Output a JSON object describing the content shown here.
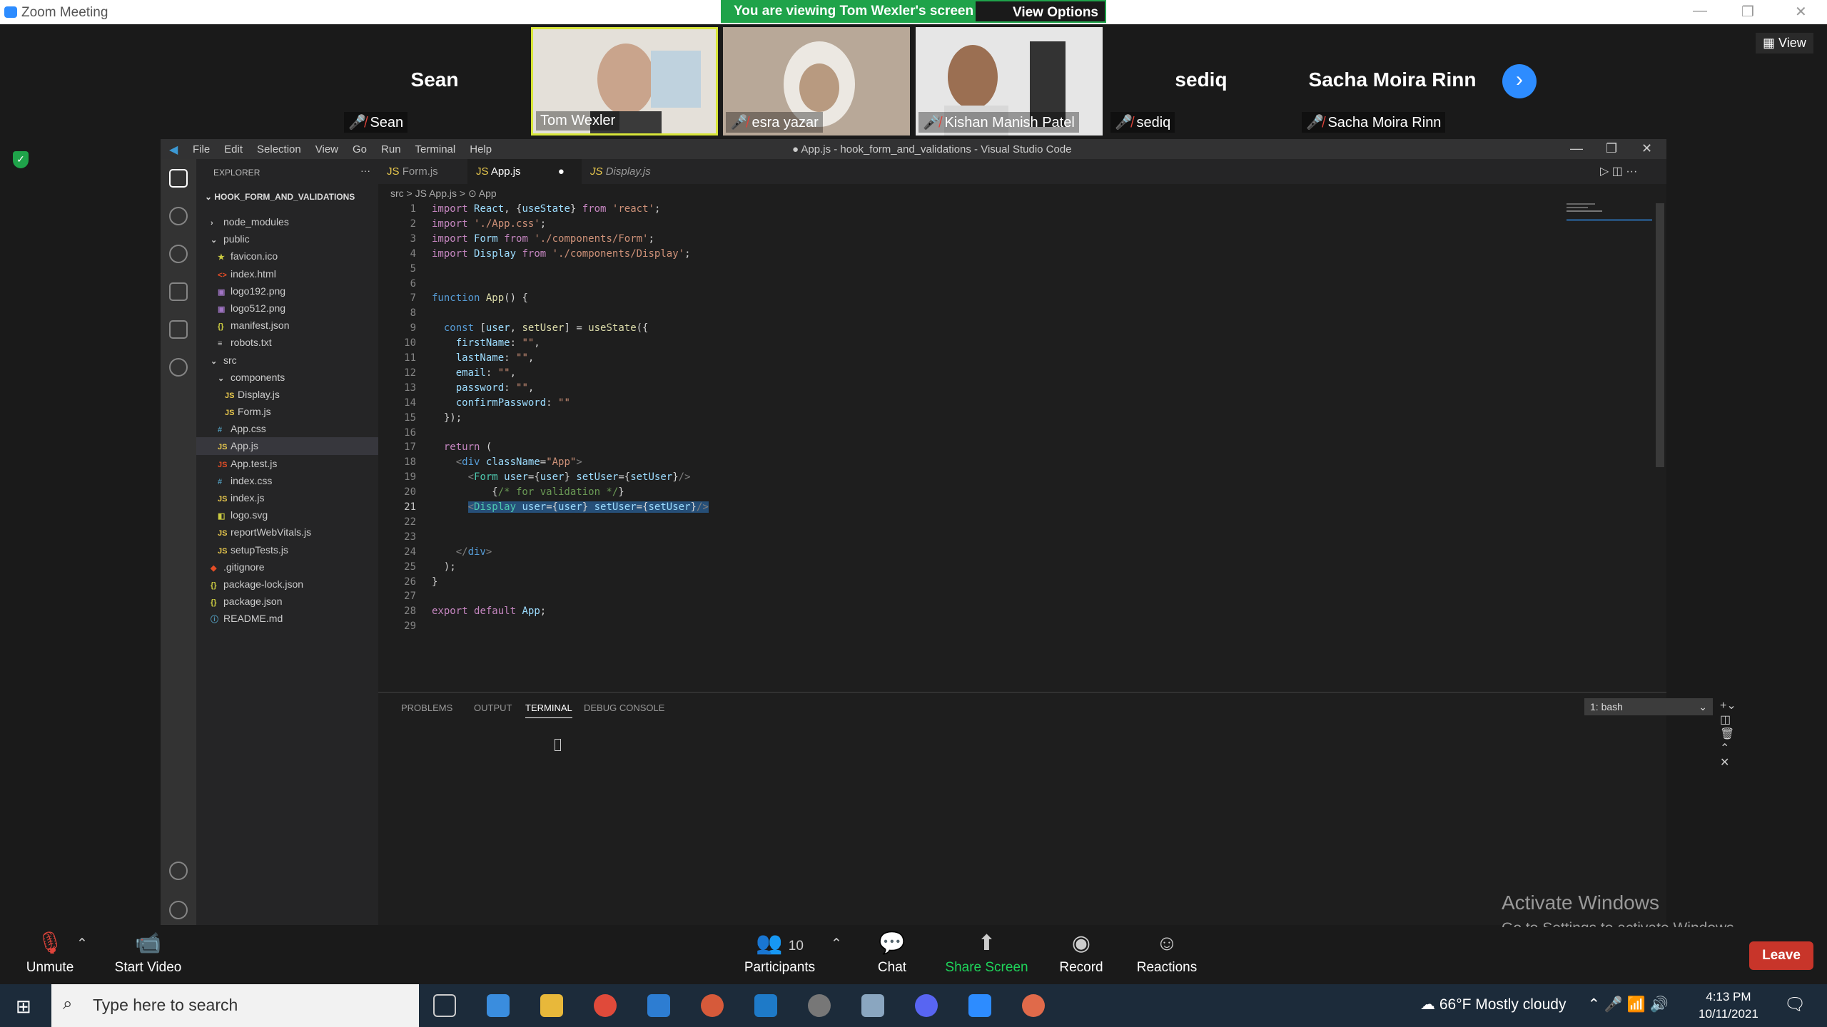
{
  "zoom": {
    "window_title": "Zoom Meeting",
    "viewing_text": "You are viewing Tom Wexler's screen",
    "view_options": "View Options",
    "view_label": "View",
    "participants": [
      {
        "big": "Sean",
        "name": "Sean",
        "video": false
      },
      {
        "big": "",
        "name": "Tom Wexler",
        "video": true
      },
      {
        "big": "",
        "name": "esra yazar",
        "video": true
      },
      {
        "big": "",
        "name": "Kishan Manish Patel",
        "video": true
      },
      {
        "big": "sediq",
        "name": "sediq",
        "video": false
      },
      {
        "big": "Sacha Moira Rinn",
        "name": "Sacha Moira Rinn",
        "video": false
      }
    ],
    "controls": {
      "unmute": "Unmute",
      "start_video": "Start Video",
      "participants": "Participants",
      "participants_count": "10",
      "chat": "Chat",
      "share_screen": "Share Screen",
      "record": "Record",
      "reactions": "Reactions",
      "leave": "Leave"
    }
  },
  "vscode": {
    "title": "● App.js - hook_form_and_validations - Visual Studio Code",
    "menu": [
      "File",
      "Edit",
      "Selection",
      "View",
      "Go",
      "Run",
      "Terminal",
      "Help"
    ],
    "explorer_label": "EXPLORER",
    "project": "HOOK_FORM_AND_VALIDATIONS",
    "tree": [
      {
        "t": "node_modules",
        "i": "›",
        "c": "",
        "d": 0
      },
      {
        "t": "public",
        "i": "⌄",
        "c": "",
        "d": 0
      },
      {
        "t": "favicon.ico",
        "i": "★",
        "c": "json",
        "d": 1
      },
      {
        "t": "index.html",
        "i": "<>",
        "c": "htm",
        "d": 1
      },
      {
        "t": "logo192.png",
        "i": "▣",
        "c": "img",
        "d": 1
      },
      {
        "t": "logo512.png",
        "i": "▣",
        "c": "img",
        "d": 1
      },
      {
        "t": "manifest.json",
        "i": "{}",
        "c": "json",
        "d": 1
      },
      {
        "t": "robots.txt",
        "i": "≡",
        "c": "",
        "d": 1
      },
      {
        "t": "src",
        "i": "⌄",
        "c": "",
        "d": 0
      },
      {
        "t": "components",
        "i": "⌄",
        "c": "",
        "d": 1
      },
      {
        "t": "Display.js",
        "i": "JS",
        "c": "js",
        "d": 2
      },
      {
        "t": "Form.js",
        "i": "JS",
        "c": "js",
        "d": 2
      },
      {
        "t": "App.css",
        "i": "#",
        "c": "css",
        "d": 1
      },
      {
        "t": "App.js",
        "i": "JS",
        "c": "js",
        "d": 1,
        "sel": true
      },
      {
        "t": "App.test.js",
        "i": "JS",
        "c": "htm",
        "d": 1
      },
      {
        "t": "index.css",
        "i": "#",
        "c": "css",
        "d": 1
      },
      {
        "t": "index.js",
        "i": "JS",
        "c": "js",
        "d": 1
      },
      {
        "t": "logo.svg",
        "i": "◧",
        "c": "json",
        "d": 1
      },
      {
        "t": "reportWebVitals.js",
        "i": "JS",
        "c": "js",
        "d": 1
      },
      {
        "t": "setupTests.js",
        "i": "JS",
        "c": "js",
        "d": 1
      },
      {
        "t": ".gitignore",
        "i": "◆",
        "c": "htm",
        "d": 0
      },
      {
        "t": "package-lock.json",
        "i": "{}",
        "c": "json",
        "d": 0
      },
      {
        "t": "package.json",
        "i": "{}",
        "c": "json",
        "d": 0
      },
      {
        "t": "README.md",
        "i": "ⓘ",
        "c": "inf",
        "d": 0
      }
    ],
    "tabs": [
      "Form.js",
      "App.js",
      "Display.js"
    ],
    "breadcrumb": "src > JS App.js > ⊙ App",
    "panel_tabs": [
      "PROBLEMS",
      "OUTPUT",
      "TERMINAL",
      "DEBUG CONSOLE"
    ],
    "terminal_select": "1: bash",
    "activate_title": "Activate Windows",
    "activate_sub": "Go to Settings to activate Windows.",
    "lines": [
      "1",
      "2",
      "3",
      "4",
      "5",
      "6",
      "7",
      "8",
      "9",
      "10",
      "11",
      "12",
      "13",
      "14",
      "15",
      "16",
      "17",
      "18",
      "19",
      "20",
      "21",
      "22",
      "23",
      "24",
      "25",
      "26",
      "27",
      "28",
      "29"
    ]
  },
  "taskbar": {
    "search_placeholder": "Type here to search",
    "weather": "66°F  Mostly cloudy",
    "time": "4:13 PM",
    "date": "10/11/2021"
  },
  "colors": {
    "zoom_blue": "#2d8cff",
    "leave_red": "#c8352a",
    "share_green": "#1fa34a"
  }
}
